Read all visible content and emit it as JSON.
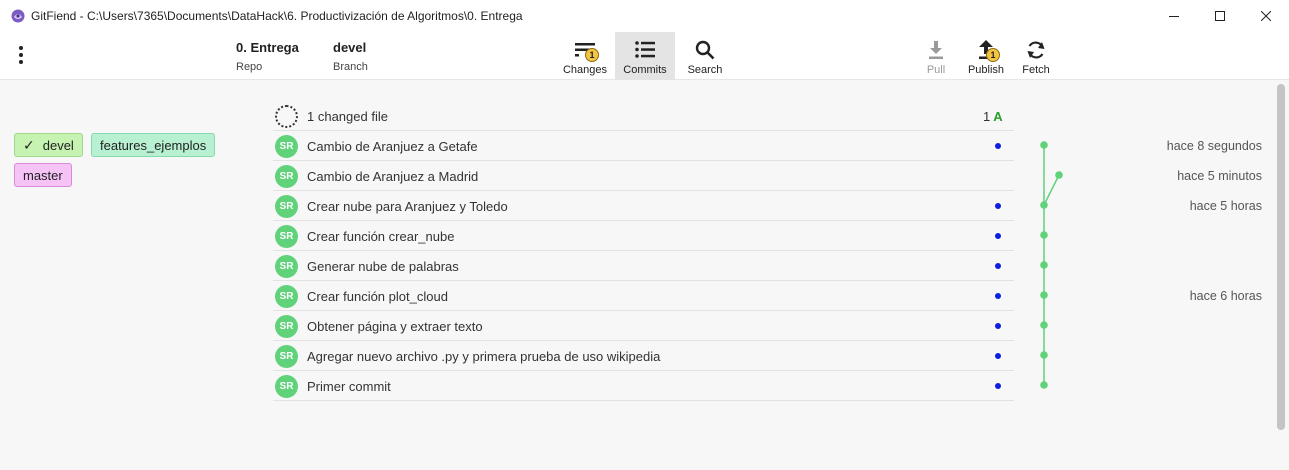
{
  "window": {
    "title": "GitFiend - C:\\Users\\7365\\Documents\\DataHack\\6. Productivización de Algoritmos\\0. Entrega"
  },
  "toolbar": {
    "repo_value": "0. Entrega",
    "repo_label": "Repo",
    "branch_value": "devel",
    "branch_label": "Branch",
    "changes_label": "Changes",
    "changes_badge": "1",
    "commits_label": "Commits",
    "search_label": "Search",
    "pull_label": "Pull",
    "publish_label": "Publish",
    "publish_badge": "1",
    "fetch_label": "Fetch"
  },
  "branches": {
    "devel": "devel",
    "devel_check": "✓",
    "features": "features_ejemplos",
    "master": "master"
  },
  "changes_row": {
    "label": "1 changed file",
    "count": "1",
    "status": "A"
  },
  "commits": [
    {
      "author": "SR",
      "message": "Cambio de Aranjuez a Getafe",
      "time": "hace 8 segundos"
    },
    {
      "author": "SR",
      "message": "Cambio de Aranjuez a Madrid",
      "time": "hace 5 minutos"
    },
    {
      "author": "SR",
      "message": "Crear nube para Aranjuez y Toledo",
      "time": "hace 5 horas"
    },
    {
      "author": "SR",
      "message": "Crear función crear_nube",
      "time": ""
    },
    {
      "author": "SR",
      "message": "Generar nube de palabras",
      "time": ""
    },
    {
      "author": "SR",
      "message": "Crear función plot_cloud",
      "time": "hace 6 horas"
    },
    {
      "author": "SR",
      "message": "Obtener página y extraer texto",
      "time": ""
    },
    {
      "author": "SR",
      "message": "Agregar nuevo archivo .py y primera prueba de uso wikipedia",
      "time": ""
    },
    {
      "author": "SR",
      "message": "Primer commit",
      "time": ""
    }
  ],
  "colors": {
    "avatar": "#5fd27a",
    "graph": "#5fd27a",
    "remote_dot": "#0a1fe0",
    "badge": "#f4c542"
  }
}
